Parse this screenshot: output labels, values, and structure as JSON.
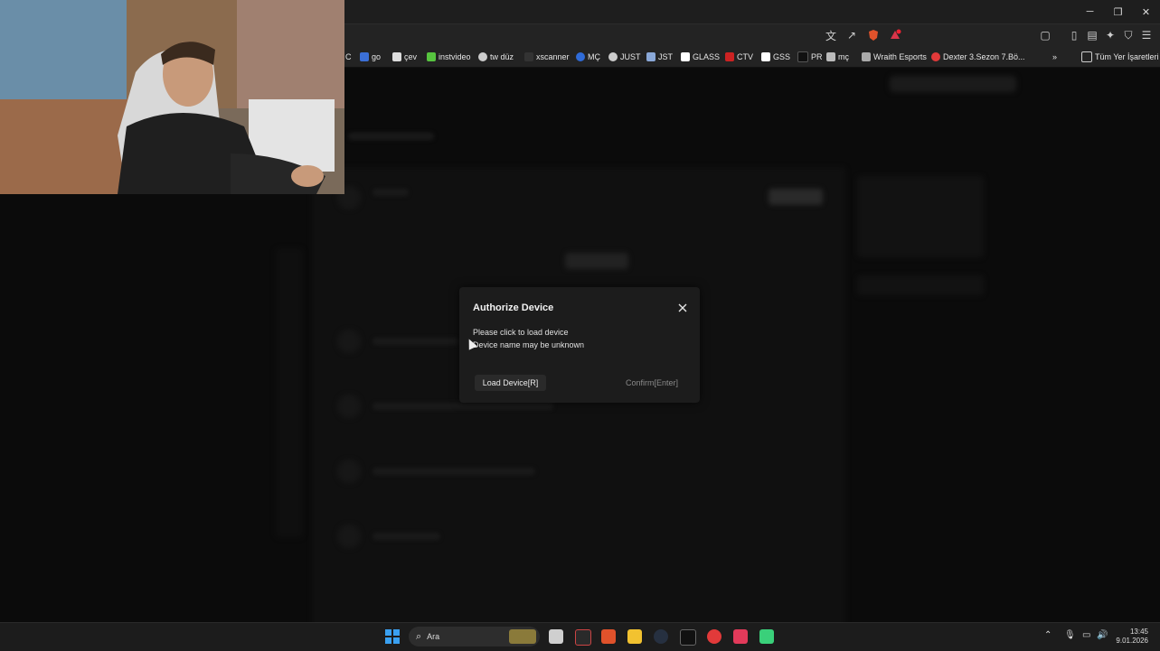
{
  "window": {
    "minimize": "─",
    "restore": "❐",
    "close": "✕"
  },
  "bookmarks": [
    {
      "label": "C",
      "color": "#4a4a4a"
    },
    {
      "label": "go",
      "color": "#3b6fd6"
    },
    {
      "label": "çev",
      "color": "#dddddd"
    },
    {
      "label": "instvideo",
      "color": "#57c43f"
    },
    {
      "label": "tw düz",
      "color": "#cccccc"
    },
    {
      "label": "xscanner",
      "color": "#333333"
    },
    {
      "label": "MÇ",
      "color": "#2f6bd8"
    },
    {
      "label": "JUST",
      "color": "#cccccc"
    },
    {
      "label": "JST",
      "color": "#8aa8d8"
    },
    {
      "label": "GLASS",
      "color": "#ffffff"
    },
    {
      "label": "CTV",
      "color": "#cc2222"
    },
    {
      "label": "GSS",
      "color": "#ffffff"
    },
    {
      "label": "PR",
      "color": "#111111"
    },
    {
      "label": "mç",
      "color": "#bbbbbb"
    },
    {
      "label": "Wraith Esports",
      "color": "#aaaaaa"
    },
    {
      "label": "Dexter 3.Sezon 7.Bö...",
      "color": "#e23a3a"
    }
  ],
  "bookmarks_overflow": "»",
  "all_bookmarks": "Tüm Yer İşaretleri",
  "modal": {
    "title": "Authorize Device",
    "line1": "Please click to load device",
    "line2": "Device name may be unknown",
    "load_button": "Load Device[R]",
    "confirm_button": "Confirm[Enter]"
  },
  "taskbar": {
    "search_placeholder": "Ara",
    "time": "13:45",
    "date": "9.01.2026"
  },
  "colors": {
    "modal_bg": "#1c1c1c",
    "page_bg": "#0c0c0c",
    "taskbar_bg": "#1c1c1c"
  }
}
